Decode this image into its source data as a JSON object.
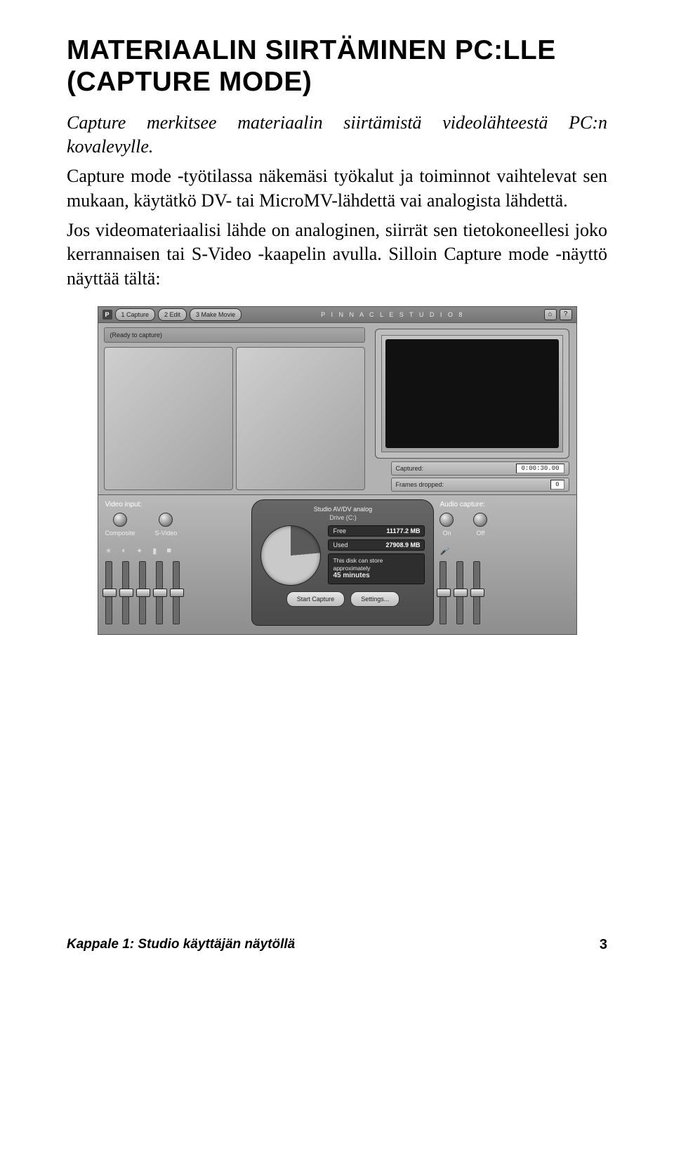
{
  "heading": "MATERIAALIN SIIRTÄMINEN PC:LLE (CAPTURE MODE)",
  "p1_lead": "Capture merkitsee materiaalin siirtämistä videolähteestä PC:n kovalevylle.",
  "p2": "Capture mode -työtilassa näkemäsi työkalut ja toiminnot vaihtelevat sen mukaan, käytätkö DV- tai MicroMV-lähdettä vai analogista lähdettä.",
  "p3": "Jos videomateriaalisi lähde on analoginen, siirrät sen tietokoneellesi joko kerrannaisen tai S-Video -kaapelin avulla. Silloin Capture mode -näyttö näyttää tältä:",
  "screenshot": {
    "logo": "P",
    "tab1": "1 Capture",
    "tab2": "2 Edit",
    "tab3": "3 Make Movie",
    "brand": "P I N N A C L E   S T U D I O   8",
    "rb1": "⌂",
    "rb2": "?",
    "status": "(Ready to capture)",
    "captured_label": "Captured:",
    "captured_value": "0:00:30.00",
    "frames_label": "Frames dropped:",
    "frames_value": "0",
    "vinput_title": "Video input:",
    "radio1": "Composite",
    "radio2": "S-Video",
    "icons": {
      "i1": "☀",
      "i2": "◐",
      "i3": "✦",
      "i4": "▮",
      "i5": "■"
    },
    "device_title": "Studio AV/DV analog",
    "drive": "Drive (C:)",
    "free_label": "Free",
    "free_value": "11177.2 MB",
    "used_label": "Used",
    "used_value": "27908.9 MB",
    "note_line1": "This disk can store",
    "note_line2": "approximately",
    "note_value": "45 minutes",
    "btn_start": "Start Capture",
    "btn_settings": "Settings...",
    "audio_title": "Audio capture:",
    "audio_on": "On",
    "audio_off": "Off",
    "audio_icon": "🎤"
  },
  "footer_text": "Kappale 1: Studio käyttäjän näytöllä",
  "footer_page": "3"
}
